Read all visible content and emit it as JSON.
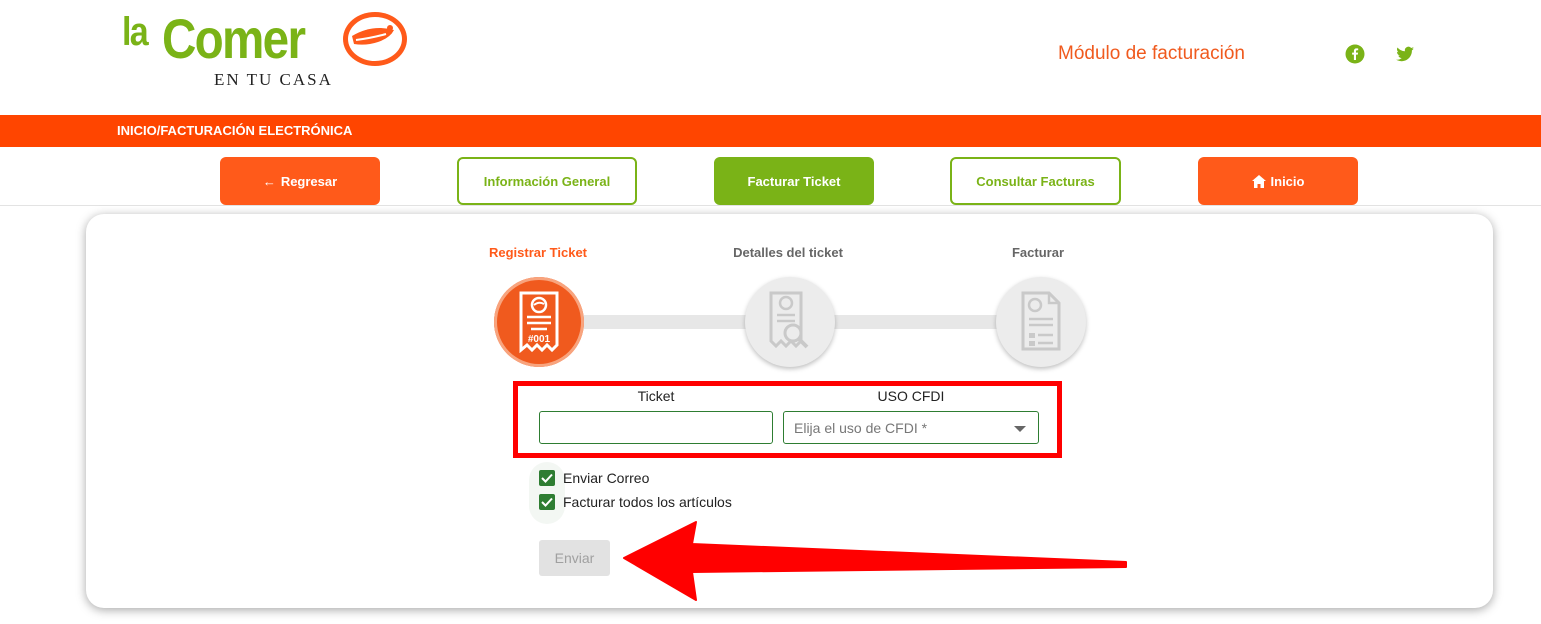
{
  "header": {
    "logo_la": "la",
    "logo_comer": "Comer",
    "logo_sub": "EN TU CASA",
    "module_title": "Módulo de facturación",
    "social": [
      "facebook-icon",
      "twitter-icon"
    ]
  },
  "breadcrumb": "INICIO/FACTURACIÓN ELECTRÓNICA",
  "nav": {
    "back": "Regresar",
    "info": "Información General",
    "invoice_ticket": "Facturar Ticket",
    "query_invoices": "Consultar Facturas",
    "home": "Inicio"
  },
  "stepper": {
    "steps": [
      {
        "label": "Registrar Ticket",
        "state": "active"
      },
      {
        "label": "Detalles del ticket",
        "state": "pending"
      },
      {
        "label": "Facturar",
        "state": "pending"
      }
    ]
  },
  "form": {
    "ticket_label": "Ticket",
    "ticket_value": "",
    "cfdi_label": "USO CFDI",
    "cfdi_placeholder": "Elija el uso de CFDI *",
    "send_email_label": "Enviar Correo",
    "send_email_checked": true,
    "invoice_all_label": "Facturar todos los artículos",
    "invoice_all_checked": true,
    "submit_label": "Enviar",
    "submit_disabled": true
  },
  "colors": {
    "brand_orange": "#ff4500",
    "accent_orange": "#ff5a1a",
    "brand_green": "#7ab317",
    "check_green": "#2e7d32",
    "annotation_red": "#ff0000"
  }
}
